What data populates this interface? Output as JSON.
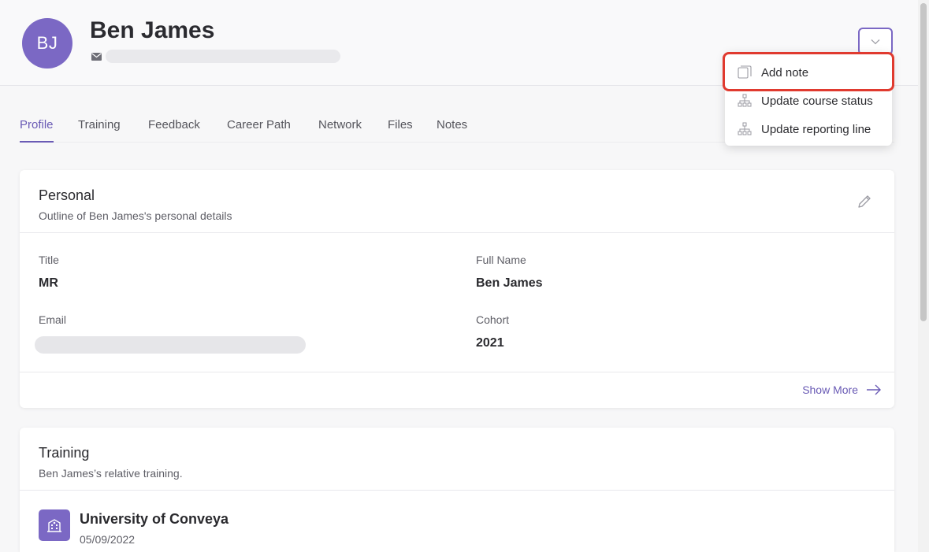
{
  "profile": {
    "initials": "BJ",
    "name": "Ben James"
  },
  "tabs": [
    "Profile",
    "Training",
    "Feedback",
    "Career Path",
    "Network",
    "Files",
    "Notes"
  ],
  "menu": {
    "items": [
      {
        "label": "Add note",
        "icon": "note-icon"
      },
      {
        "label": "Update course status",
        "icon": "hierarchy-icon"
      },
      {
        "label": "Update reporting line",
        "icon": "hierarchy-icon"
      }
    ]
  },
  "personal": {
    "title": "Personal",
    "subtitle": "Outline of Ben James's personal details",
    "fields": {
      "title_label": "Title",
      "title_value": "MR",
      "fullname_label": "Full Name",
      "fullname_value": "Ben James",
      "email_label": "Email",
      "cohort_label": "Cohort",
      "cohort_value": "2021"
    },
    "show_more": "Show More"
  },
  "training": {
    "title": "Training",
    "subtitle": "Ben James’s relative training.",
    "item_name": "University of Conveya",
    "item_date": "05/09/2022"
  },
  "colors": {
    "accent": "#6a5bb5",
    "avatar": "#7b68c4",
    "highlight": "#e03a2f"
  }
}
